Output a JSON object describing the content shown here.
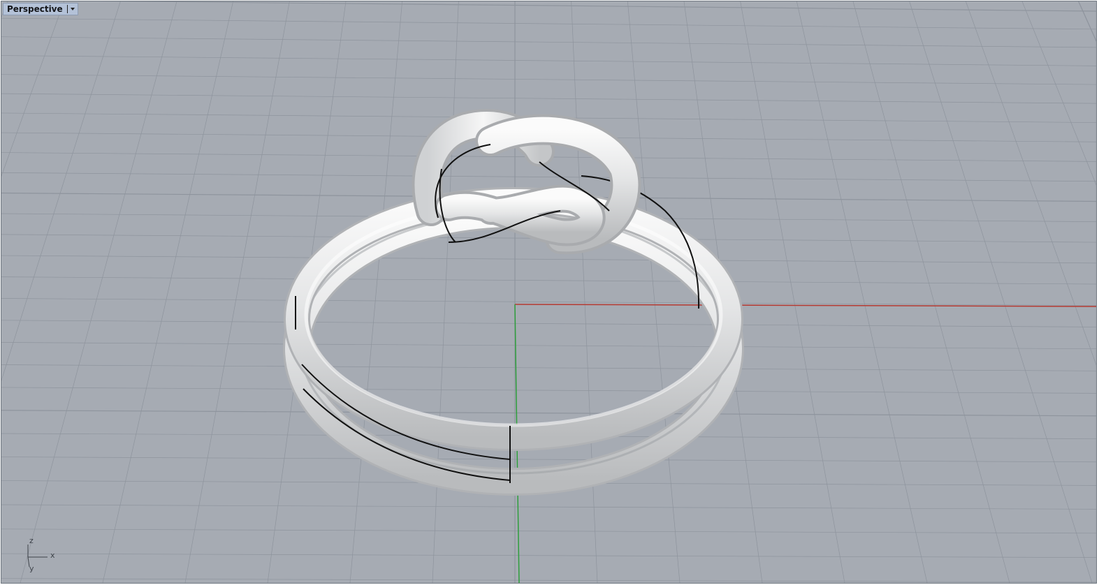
{
  "viewport": {
    "name": "Perspective",
    "background": "#a6abb3",
    "grid_color": "#8e949d",
    "x_axis_color": "#b53a32",
    "y_axis_color": "#2e9e3c"
  },
  "axes_widget": {
    "x": "x",
    "y": "y",
    "z": "z"
  },
  "model": {
    "icon": "knot-ring-icon",
    "color": "#e6e7e8"
  }
}
